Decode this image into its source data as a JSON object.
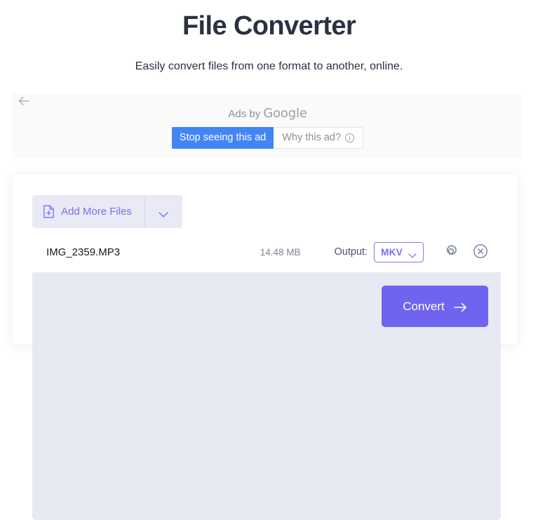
{
  "header": {
    "title": "File Converter",
    "subtitle": "Easily convert files from one format to another, online."
  },
  "ad": {
    "back_arrow_icon": "arrow-left-icon",
    "byline_prefix": "Ads by ",
    "byline_brand": "Google",
    "stop_button_label": "Stop seeing this ad",
    "why_button_label": "Why this ad?",
    "why_info_icon": "info-icon",
    "stop_button_color": "#4285f4"
  },
  "converter": {
    "add_more_files_label": "Add More Files",
    "add_more_files_icon": "file-plus-icon",
    "add_more_files_caret_icon": "chevron-down-icon",
    "accent_color": "#6f64f0",
    "file": {
      "name": "IMG_2359.MP3",
      "size": "14.48 MB",
      "output_label": "Output:",
      "output_value": "MKV",
      "output_caret_icon": "chevron-down-icon",
      "settings_icon": "gear-icon",
      "remove_icon": "close-circle-icon"
    },
    "convert_button_label": "Convert",
    "convert_button_icon": "arrow-right-icon"
  }
}
